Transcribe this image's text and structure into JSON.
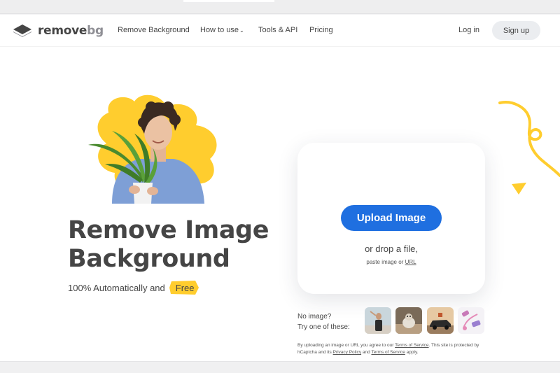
{
  "header": {
    "logo": {
      "text_main": "remove",
      "text_accent": "bg",
      "icon": "layers-logo-icon"
    },
    "nav": [
      {
        "label": "Remove Background"
      },
      {
        "label": "How to use",
        "icon": "chevron-down-icon"
      },
      {
        "label": "Tools & API"
      },
      {
        "label": "Pricing"
      }
    ],
    "login_label": "Log in",
    "signup_label": "Sign up"
  },
  "hero": {
    "title_line1": "Remove Image",
    "title_line2": "Background",
    "subtitle": "100% Automatically and",
    "badge": "Free"
  },
  "upload": {
    "button_label": "Upload Image",
    "drop_text": "or drop a file,",
    "paste_text": "paste image or",
    "url_link": "URL"
  },
  "samples": {
    "line1": "No image?",
    "line2": "Try one of these:",
    "thumbnails": [
      "person-photo",
      "animal-photo",
      "car-photo",
      "product-photo"
    ]
  },
  "legal": {
    "part1": "By uploading an image or URL you agree to our",
    "terms_link": "Terms of Service",
    "part2": ". This site is protected by hCaptcha and its",
    "privacy_link": "Privacy Policy",
    "part3": "and",
    "terms2_link": "Terms of Service",
    "part4": "apply."
  },
  "colors": {
    "accent_blue": "#1f6fe0",
    "accent_yellow": "#ffcd2e",
    "text_dark": "#454545"
  }
}
